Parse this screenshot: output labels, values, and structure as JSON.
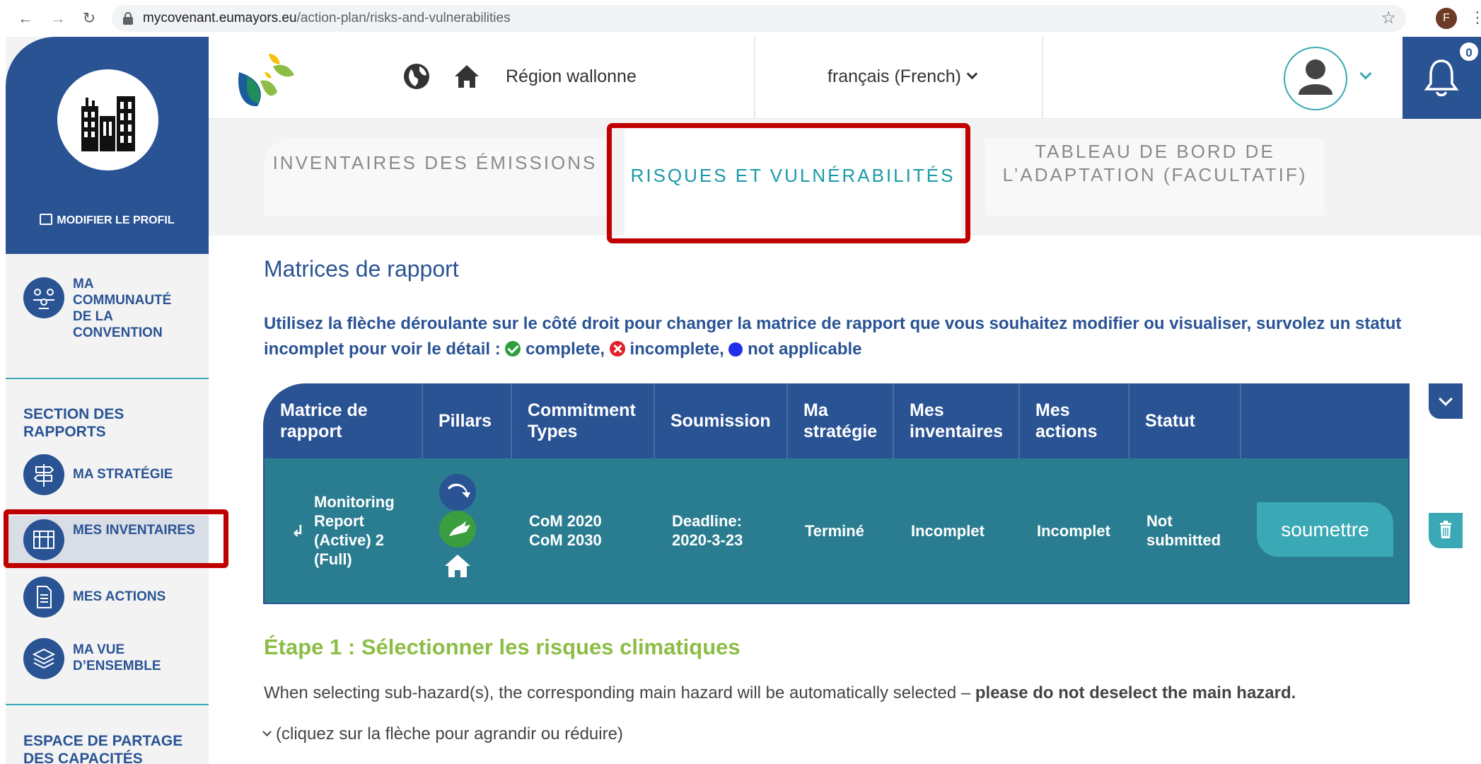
{
  "browser": {
    "url_domain": "mycovenant.eumayors.eu",
    "url_path": "/action-plan/risks-and-vulnerabilities",
    "profile_initial": "F"
  },
  "sidebar": {
    "edit_profile": "MODIFIER LE PROFIL",
    "community": "MA COMMUNAUTÉ DE LA CONVENTION",
    "reports_heading": "SECTION DES RAPPORTS",
    "items": [
      {
        "label": "MA STRATÉGIE",
        "icon": "signpost-icon"
      },
      {
        "label": "MES INVENTAIRES",
        "icon": "inventory-map-icon"
      },
      {
        "label": "MES ACTIONS",
        "icon": "document-icon"
      },
      {
        "label": "MA VUE D’ENSEMBLE",
        "icon": "layers-icon"
      }
    ],
    "capacity_heading": "ESPACE DE PARTAGE DES CAPACITÉS"
  },
  "header": {
    "region": "Région wallonne",
    "language": "français (French)",
    "notification_count": "0"
  },
  "tabs": [
    {
      "label": "INVENTAIRES DES ÉMISSIONS"
    },
    {
      "label": "RISQUES ET VULNÉRABILITÉS"
    },
    {
      "label": "TABLEAU DE BORD DE L’ADAPTATION (FACULTATIF)"
    }
  ],
  "main": {
    "title": "Matrices de rapport",
    "intro": "Utilisez la flèche déroulante sur le côté droit pour changer la matrice de rapport que vous souhaitez modifier ou visualiser, survolez un statut incomplet pour voir le détail :",
    "legend_complete": "complete,",
    "legend_incomplete": "incomplete,",
    "legend_na": "not applicable"
  },
  "table": {
    "headers": [
      "Matrice de rapport",
      "Pillars",
      "Commitment Types",
      "Soumission",
      "Ma stratégie",
      "Mes inventaires",
      "Mes actions",
      "Statut"
    ],
    "row": {
      "matrix": "Monitoring Report (Active) 2 (Full)",
      "commitment": "CoM 2020 CoM 2030",
      "submission": "Deadline: 2020-3-23",
      "strategy": "Terminé",
      "inventories": "Incomplet",
      "actions": "Incomplet",
      "status": "Not submitted",
      "submit_label": "soumettre"
    }
  },
  "step": {
    "title": "Étape 1 : Sélectionner les risques climatiques",
    "note": "When selecting sub-hazard(s), the corresponding main hazard will be automatically selected –",
    "note_bold": "please do not deselect the main hazard.",
    "collapse_hint": "(cliquez sur la flèche pour agrandir ou réduire)"
  },
  "colors": {
    "primary": "#2a5394",
    "teal": "#3aa9b5",
    "row_bg": "#2a7d91",
    "step_green": "#8cbd45",
    "highlight_red": "#c00000"
  }
}
